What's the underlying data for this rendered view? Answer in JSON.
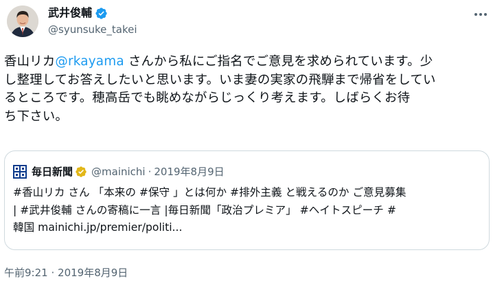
{
  "author": {
    "display_name": "武井俊輔",
    "handle": "@syunsuke_takei",
    "avatar_icon": "avatar-photo",
    "verified_icon": "verified-badge-icon"
  },
  "tweet": {
    "lines": [
      {
        "pre": "香山リカ",
        "mention": "@rkayama",
        "post": " さんから私にご指名でご意見を求められています。少"
      },
      {
        "text": "し整理してお答えしたいと思います。いま妻の実家の飛騨まで帰省をしてい"
      },
      {
        "text": "るところです。穂高岳でも眺めながらじっくり考えます。しばらくお待"
      },
      {
        "text": "ち下さい。"
      }
    ]
  },
  "quote": {
    "name": "毎日新聞",
    "handle": "@mainichi",
    "separator": "·",
    "date": "2019年8月9日",
    "lines": [
      "#香山リカ さん 「本来の #保守 」とは何か #排外主義 と戦えるのか ご意見募集",
      "| #武井俊輔 さんの寄稿に一言 |毎日新聞「政治プレミア」 #ヘイトスピーチ #",
      "韓国 mainichi.jp/premier/politi..."
    ],
    "logo_icon": "mainichi-logo-icon",
    "verified_icon": "gold-verified-badge-icon"
  },
  "timestamp": {
    "time": "午前9:21",
    "separator": "·",
    "date": "2019年8月9日"
  },
  "colors": {
    "link": "#1d9bf0",
    "secondary_text": "#536471",
    "border": "#cfd9de",
    "verified_blue": "#1d9bf0",
    "verified_gold": "#e2b719"
  }
}
